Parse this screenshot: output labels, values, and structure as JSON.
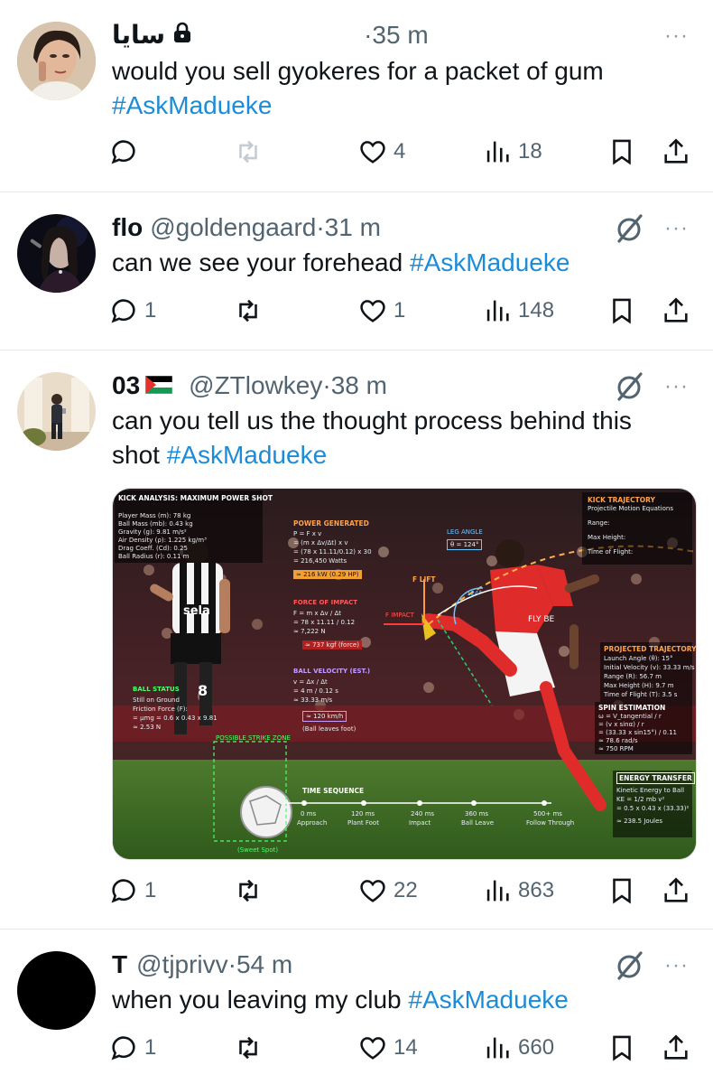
{
  "tweets": [
    {
      "name": "سايا",
      "handle": "",
      "time": "35 m",
      "text": "would you sell gyokeres for a packet of gum",
      "hashtag": "#AskMadueke",
      "replies": "",
      "reposts": "",
      "likes": "4",
      "views": "18",
      "locked": true,
      "grok": false
    },
    {
      "name": "flo",
      "handle": "@goldengaard",
      "time": "31 m",
      "text": "can we see your forehead",
      "hashtag": "#AskMadueke",
      "replies": "1",
      "reposts": "",
      "likes": "1",
      "views": "148",
      "grok": true
    },
    {
      "name": "03",
      "handle": "@ZTlowkey",
      "time": "38 m",
      "text_line1": "can you tell us the thought process behind this",
      "text_line2": "shot",
      "hashtag": "#AskMadueke",
      "replies": "1",
      "reposts": "",
      "likes": "22",
      "views": "863",
      "flag": "palestine-flag",
      "grok": true
    },
    {
      "name": "T",
      "handle": "@tjprivv",
      "time": "54 m",
      "text": "when you leaving my club",
      "hashtag": "#AskMadueke",
      "replies": "1",
      "reposts": "",
      "likes": "14",
      "views": "660",
      "grok": true
    }
  ],
  "separator": "·",
  "more_glyph": "···",
  "media": {
    "left_panel_title": "KICK ANALYSIS: MAXIMUM POWER SHOT",
    "left_panel_lines": [
      "Player Mass (m): 78 kg",
      "Ball Mass (mb): 0.43 kg",
      "Gravity (g): 9.81 m/s²",
      "Air Density (ρ): 1.225 kg/m³",
      "Drag Coeff. (Cd): 0.25",
      "Ball Radius (r): 0.11 m"
    ],
    "power_title": "POWER GENERATED",
    "power_lines": [
      "P = F x v",
      "= (m x Δv/Δt) x v",
      "= (78 x 11.11/0.12) x 30",
      "= 216,450 Watts"
    ],
    "power_result": "≈ 216 kW (0.29 HP)",
    "leg_angle_title": "LEG ANGLE",
    "leg_angle_value": "θ = 124°",
    "leg_angle_arc": "124°",
    "lift_label": "F LIFT",
    "impact_label": "F IMPACT",
    "force_title": "FORCE OF IMPACT",
    "force_lines": [
      "F = m x Δv / Δt",
      "= 78 x 11.11 / 0.12",
      "≈ 7,222 N"
    ],
    "force_result": "≈ 737 kgf (force)",
    "velocity_title": "BALL VELOCITY (EST.)",
    "velocity_lines": [
      "v = Δx / Δt",
      "= 4 m / 0.12 s",
      "≈ 33.33 m/s"
    ],
    "velocity_result": "≈ 120 km/h",
    "velocity_note": "(Ball leaves foot)",
    "ball_status_title": "BALL STATUS",
    "ball_status_lines": [
      "Still on Ground",
      "Friction Force (F):",
      "= μmg = 0.6 x 0.43 x 9.81",
      "≈ 2.53 N"
    ],
    "strike_zone": "POSSIBLE STRIKE ZONE",
    "sweet_spot": "(Sweet Spot)",
    "trajectory_title": "KICK TRAJECTORY",
    "trajectory_sub": "Projectile Motion Equations",
    "trajectory_lines": [
      "Range:",
      "Max Height:",
      "Time of Flight:"
    ],
    "projected_title": "PROJECTED TRAJECTORY (EST.)",
    "projected_lines": [
      "Launch Angle (θ): 15°",
      "Initial Velocity (v): 33.33 m/s",
      "Range (R): 56.7 m",
      "Max Height (H): 9.7 m",
      "Time of Flight (T): 3.5 s"
    ],
    "spin_title": "SPIN ESTIMATION",
    "spin_lines": [
      "ω = V_tangential / r",
      "= (v x sinα) / r",
      "= (33.33 x sin15°) / 0.11",
      "≈ 78.6 rad/s",
      "≈ 750 RPM"
    ],
    "energy_title": "ENERGY TRANSFER",
    "energy_lines": [
      "Kinetic Energy to Ball",
      "KE = 1/2 mb v²",
      "= 0.5 x 0.43 x (33.33)²",
      "≈ 238.5 Joules"
    ],
    "time_title": "TIME SEQUENCE",
    "time_steps": [
      "0 ms",
      "120 ms",
      "240 ms",
      "360 ms",
      "500+ ms"
    ],
    "time_labels": [
      "Approach",
      "Plant Foot",
      "Impact",
      "Ball Leave",
      "Follow Through"
    ],
    "sponsor": "sela",
    "shirt_text": "FLY BE",
    "shirt_number": "8"
  },
  "colors": {
    "text": "#0f1419",
    "secondary": "#536471",
    "hashtag": "#1d8cd8",
    "divider": "#e6e9ec",
    "accent_orange": "#ffa24a"
  }
}
